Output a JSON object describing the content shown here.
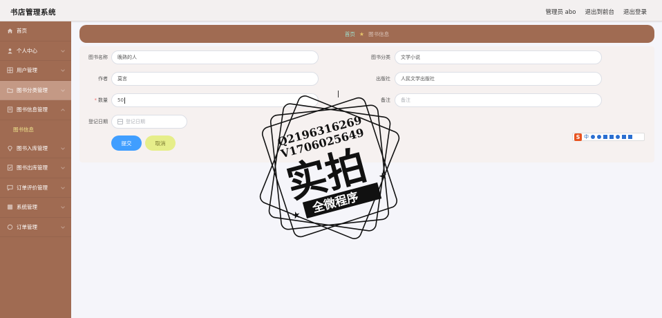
{
  "app_title": "书店管理系统",
  "header": {
    "admin_label": "管理员 abo",
    "back_to_front": "退出到前台",
    "logout": "退出登录"
  },
  "sidebar": {
    "items": [
      {
        "label": "首页",
        "icon": "home-icon"
      },
      {
        "label": "个人中心",
        "icon": "user-icon"
      },
      {
        "label": "用户管理",
        "icon": "grid-icon"
      },
      {
        "label": "图书分类管理",
        "icon": "folder-icon",
        "active": true
      },
      {
        "label": "图书信息管理",
        "icon": "book-icon"
      },
      {
        "label": "图书入库管理",
        "icon": "pin-icon"
      },
      {
        "label": "图书出库管理",
        "icon": "doc-icon"
      },
      {
        "label": "订单评价管理",
        "icon": "chat-icon"
      },
      {
        "label": "系统管理",
        "icon": "settings-icon"
      },
      {
        "label": "订单管理",
        "icon": "order-icon"
      }
    ],
    "sub_item": "图书信息"
  },
  "breadcrumb": {
    "home": "首页",
    "current": "图书信息"
  },
  "form": {
    "name_label": "图书名称",
    "name_value": "晚熟的人",
    "category_label": "图书分类",
    "category_value": "文学小说",
    "author_label": "作者",
    "author_value": "莫言",
    "publisher_label": "出版社",
    "publisher_value": "人民文学出版社",
    "qty_label": "数量",
    "qty_value": "50",
    "note_label": "备注",
    "note_placeholder": "备注",
    "date_label": "登记日期",
    "date_placeholder": "登记日期",
    "submit": "提交",
    "cancel": "取消"
  },
  "ime": {
    "logo": "S",
    "lang": "中"
  },
  "watermark": {
    "line1": "Q2196316269",
    "line2": "V1706025649",
    "big": "实拍",
    "banner": "全微程序"
  },
  "colors": {
    "sidebar": "#a06b52",
    "active_item": "#c49985",
    "submenu_text": "#f0e68c",
    "submit_button": "#409eff",
    "cancel_button": "#e6ee8a"
  }
}
